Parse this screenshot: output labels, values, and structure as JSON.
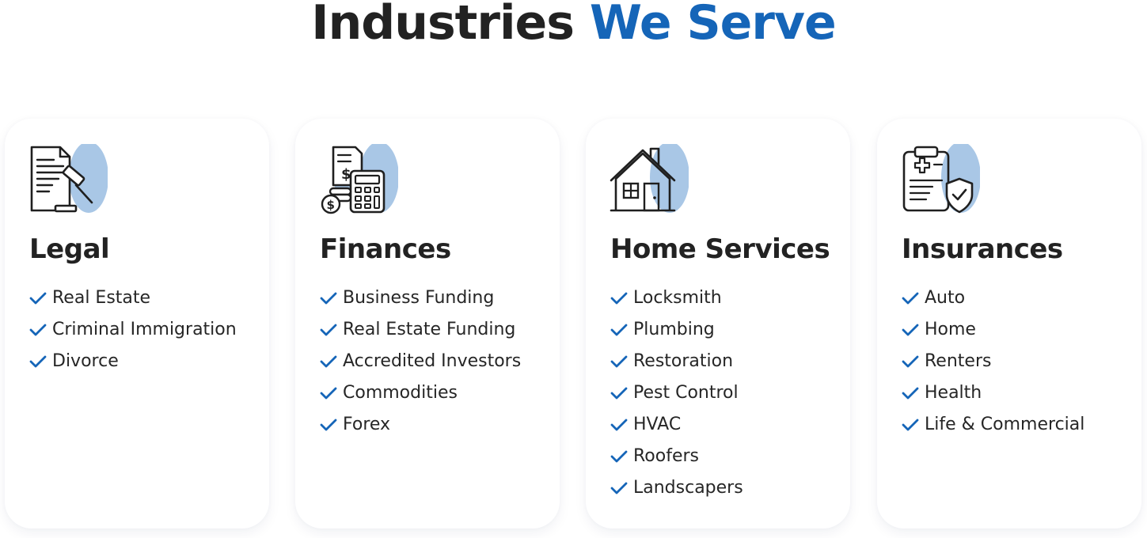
{
  "section": {
    "title_main": "Industries",
    "title_accent": "We Serve"
  },
  "colors": {
    "accent": "#1565b8",
    "icon_blob": "#a9c7e6",
    "text": "#222222"
  },
  "cards": [
    {
      "icon": "legal-document-gavel-icon",
      "title": "Legal",
      "items": [
        "Real Estate",
        "Criminal Immigration",
        "Divorce"
      ]
    },
    {
      "icon": "finance-calculator-coins-icon",
      "title": "Finances",
      "items": [
        "Business Funding",
        "Real Estate Funding",
        "Accredited Investors",
        "Commodities",
        "Forex"
      ]
    },
    {
      "icon": "house-icon",
      "title": "Home Services",
      "items": [
        "Locksmith",
        "Plumbing",
        "Restoration",
        "Pest Control",
        "HVAC",
        "Roofers",
        "Landscapers"
      ]
    },
    {
      "icon": "insurance-clipboard-shield-icon",
      "title": "Insurances",
      "items": [
        "Auto",
        "Home",
        "Renters",
        "Health",
        "Life & Commercial"
      ]
    }
  ]
}
